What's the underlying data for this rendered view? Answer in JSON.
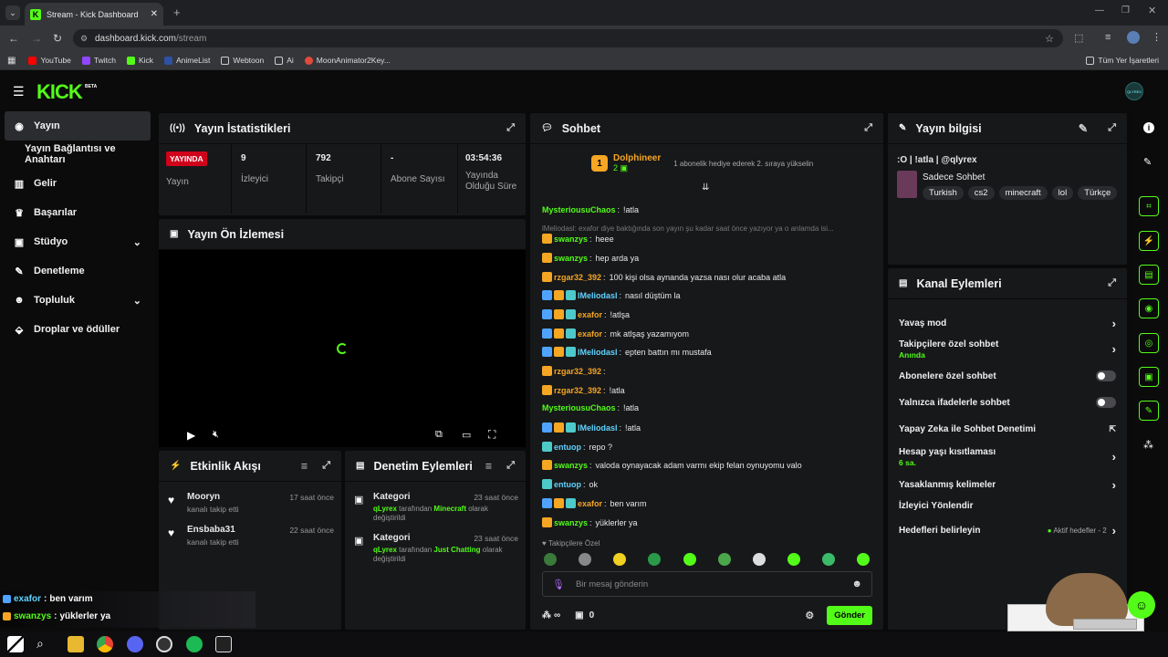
{
  "browser": {
    "tab_title": "Stream - Kick Dashboard",
    "url_domain": "dashboard.kick.com",
    "url_path": "/stream",
    "bookmarks": [
      "YouTube",
      "Twitch",
      "Kick",
      "AnimeList",
      "Webtoon",
      "Ai",
      "MoonAnimator2Key..."
    ],
    "bookmarks_right": "Tüm Yer İşaretleri"
  },
  "header": {
    "logo": "KICK",
    "logo_badge": "BETA",
    "avatar_label": "QLYREX"
  },
  "sidebar": {
    "items": [
      {
        "label": "Yayın",
        "icon": "broadcast-icon"
      },
      {
        "label": "Yayın Bağlantısı ve Anahtarı",
        "icon": ""
      },
      {
        "label": "Gelir",
        "icon": "chart-icon"
      },
      {
        "label": "Başarılar",
        "icon": "trophy-icon"
      },
      {
        "label": "Stüdyo",
        "icon": "studio-icon"
      },
      {
        "label": "Denetleme",
        "icon": "wrench-icon"
      },
      {
        "label": "Topluluk",
        "icon": "people-icon"
      },
      {
        "label": "Droplar ve ödüller",
        "icon": "drops-icon"
      }
    ]
  },
  "stats": {
    "title": "Yayın İstatistikleri",
    "live_badge": "YAYINDA",
    "live_label": "Yayın",
    "cells": [
      {
        "value": "9",
        "label": "İzleyici"
      },
      {
        "value": "792",
        "label": "Takipçi"
      },
      {
        "value": "-",
        "label": "Abone Sayısı"
      },
      {
        "value": "03:54:36",
        "label": "Yayında Olduğu Süre"
      }
    ]
  },
  "preview": {
    "title": "Yayın Ön İzlemesi"
  },
  "activity": {
    "title": "Etkinlik Akışı",
    "items": [
      {
        "name": "Mooryn",
        "time": "17 saat önce",
        "desc": "kanalı takip etti"
      },
      {
        "name": "Ensbaba31",
        "time": "22 saat önce",
        "desc": "kanalı takip etti"
      }
    ]
  },
  "mod_actions": {
    "title": "Denetim Eylemleri",
    "items": [
      {
        "title": "Kategori",
        "time": "23 saat önce",
        "user": "qLyrex",
        "mid": " tarafından ",
        "cat": "Minecraft",
        "tail": " olarak değiştirildi"
      },
      {
        "title": "Kategori",
        "time": "23 saat önce",
        "user": "qLyrex",
        "mid": " tarafından ",
        "cat": "Just Chatting",
        "tail": " olarak değiştirildi"
      }
    ]
  },
  "chat": {
    "title": "Sohbet",
    "top_rank": "1",
    "top_user": "Dolphineer",
    "top_count": "2",
    "top_hint": "1 abonelik hediye ederek 2. sıraya yükselin",
    "reply_hint": "lMeliodasl: exafor diye baktığında son yayın şu kadar saat önce yazıyor ya o anlamda isi...",
    "messages": [
      {
        "user": "MysteriousuChaos",
        "text": "!atla",
        "color": "u-lime",
        "badges": []
      },
      {
        "user": "swanzys",
        "text": "heee",
        "color": "u-lime",
        "badges": [
          "c"
        ]
      },
      {
        "user": "swanzys",
        "text": "hep arda ya",
        "color": "u-lime",
        "badges": [
          "c"
        ]
      },
      {
        "user": "rzgar32_392",
        "text": "100 kişi olsa aynanda yazsa nası olur acaba atla",
        "color": "u-orange",
        "badges": [
          "c"
        ]
      },
      {
        "user": "lMeliodasl",
        "text": "nasıl düştüm la",
        "color": "u-cyan",
        "badges": [
          "b",
          "c",
          "t"
        ]
      },
      {
        "user": "exafor",
        "text": "!atlşa",
        "color": "u-orange",
        "badges": [
          "b",
          "c",
          "t"
        ]
      },
      {
        "user": "exafor",
        "text": "mk atlşaş yazamıyom",
        "color": "u-orange",
        "badges": [
          "b",
          "c",
          "t"
        ]
      },
      {
        "user": "lMeliodasl",
        "text": "epten battın mı mustafa",
        "color": "u-cyan",
        "badges": [
          "b",
          "c",
          "t"
        ]
      },
      {
        "user": "rzgar32_392",
        "text": "",
        "color": "u-orange",
        "badges": [
          "c"
        ]
      },
      {
        "user": "rzgar32_392",
        "text": "!atla",
        "color": "u-orange",
        "badges": [
          "c"
        ]
      },
      {
        "user": "MysteriousuChaos",
        "text": "!atla",
        "color": "u-lime",
        "badges": []
      },
      {
        "user": "lMeliodasl",
        "text": "!atla",
        "color": "u-cyan",
        "badges": [
          "b",
          "c",
          "t"
        ]
      },
      {
        "user": "entuop",
        "text": "repo ?",
        "color": "u-cyan",
        "badges": [
          "t"
        ]
      },
      {
        "user": "swanzys",
        "text": "valoda oynayacak adam varmı ekip felan oynuyomu valo",
        "color": "u-lime",
        "badges": [
          "c"
        ]
      },
      {
        "user": "entuop",
        "text": "ok",
        "color": "u-cyan",
        "badges": [
          "t"
        ]
      },
      {
        "user": "exafor",
        "text": "ben varım",
        "color": "u-orange",
        "badges": [
          "b",
          "c",
          "t"
        ]
      },
      {
        "user": "swanzys",
        "text": "yüklerler ya",
        "color": "u-lime",
        "badges": [
          "c"
        ]
      }
    ],
    "followers_only": "Takipçilere Özel",
    "input_placeholder": "Bir mesaj gönderin",
    "points": "∞",
    "gifts": "0",
    "send": "Gönder"
  },
  "stream_info": {
    "title": "Yayın bilgisi",
    "stream_title": ":O | !atla | @qlyrex",
    "category": "Sadece Sohbet",
    "tags": [
      "Turkish",
      "cs2",
      "minecraft",
      "lol",
      "Türkçe"
    ]
  },
  "channel_actions": {
    "title": "Kanal Eylemleri",
    "rows": [
      {
        "label": "Yavaş mod",
        "sub": ""
      },
      {
        "label": "Takipçilere özel sohbet",
        "sub": "Anında"
      },
      {
        "label": "Abonelere özel sohbet",
        "sub": ""
      },
      {
        "label": "Yalnızca ifadelerle sohbet",
        "sub": ""
      },
      {
        "label": "Yapay Zeka ile Sohbet Denetimi",
        "sub": ""
      },
      {
        "label": "Hesap yaşı kısıtlaması",
        "sub": "6 sa."
      },
      {
        "label": "Yasaklanmış kelimeler",
        "sub": ""
      },
      {
        "label": "İzleyici Yönlendir",
        "sub": ""
      },
      {
        "label": "Hedefleri belirleyin",
        "sub": "Aktif hedefler - 2"
      }
    ]
  },
  "overlay_chat": [
    {
      "user": "exafor",
      "text": "ben varım"
    },
    {
      "user": "swanzys",
      "text": "yüklerler ya"
    }
  ],
  "colors": {
    "accent": "#53fc18",
    "panel": "#17181a",
    "bg": "#0a0a0b"
  }
}
